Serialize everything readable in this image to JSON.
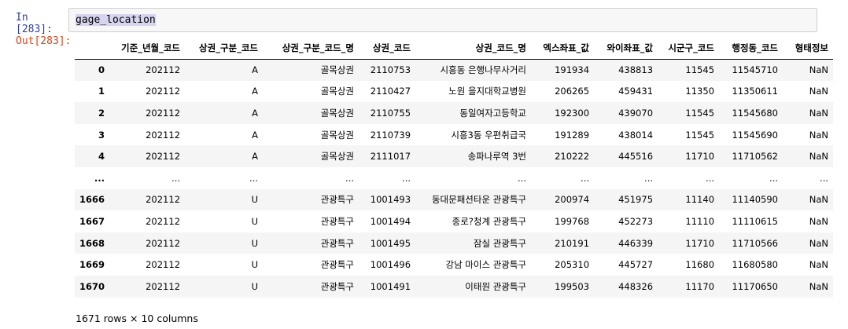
{
  "prompts": {
    "in": "In [283]:",
    "out": "Out[283]:"
  },
  "cell": {
    "code": "gage_location"
  },
  "dataframe": {
    "columns": [
      "",
      "기준_년월_코드",
      "상권_구분_코드",
      "상권_구분_코드_명",
      "상권_코드",
      "상권_코드_명",
      "엑스좌표_값",
      "와이좌표_값",
      "시군구_코드",
      "행정동_코드",
      "형태정보"
    ],
    "rows": [
      [
        "0",
        "202112",
        "A",
        "골목상권",
        "2110753",
        "시흥동 은행나무사거리",
        "191934",
        "438813",
        "11545",
        "11545710",
        "NaN"
      ],
      [
        "1",
        "202112",
        "A",
        "골목상권",
        "2110427",
        "노원 을지대학교병원",
        "206265",
        "459431",
        "11350",
        "11350611",
        "NaN"
      ],
      [
        "2",
        "202112",
        "A",
        "골목상권",
        "2110755",
        "동일여자고등학교",
        "192300",
        "439070",
        "11545",
        "11545680",
        "NaN"
      ],
      [
        "3",
        "202112",
        "A",
        "골목상권",
        "2110739",
        "시흥3동 우편취급국",
        "191289",
        "438014",
        "11545",
        "11545690",
        "NaN"
      ],
      [
        "4",
        "202112",
        "A",
        "골목상권",
        "2111017",
        "송파나루역 3번",
        "210222",
        "445516",
        "11710",
        "11710562",
        "NaN"
      ],
      [
        "...",
        "...",
        "...",
        "...",
        "...",
        "...",
        "...",
        "...",
        "...",
        "...",
        "..."
      ],
      [
        "1666",
        "202112",
        "U",
        "관광특구",
        "1001493",
        "동대문패션타운 관광특구",
        "200974",
        "451975",
        "11140",
        "11140590",
        "NaN"
      ],
      [
        "1667",
        "202112",
        "U",
        "관광특구",
        "1001494",
        "종로?청계 관광특구",
        "199768",
        "452273",
        "11110",
        "11110615",
        "NaN"
      ],
      [
        "1668",
        "202112",
        "U",
        "관광특구",
        "1001495",
        "잠실 관광특구",
        "210191",
        "446339",
        "11710",
        "11710566",
        "NaN"
      ],
      [
        "1669",
        "202112",
        "U",
        "관광특구",
        "1001496",
        "강남 마이스 관광특구",
        "205310",
        "445727",
        "11680",
        "11680580",
        "NaN"
      ],
      [
        "1670",
        "202112",
        "U",
        "관광특구",
        "1001491",
        "이태원 관광특구",
        "199503",
        "448326",
        "11170",
        "11170650",
        "NaN"
      ]
    ],
    "summary": "1671 rows × 10 columns"
  }
}
